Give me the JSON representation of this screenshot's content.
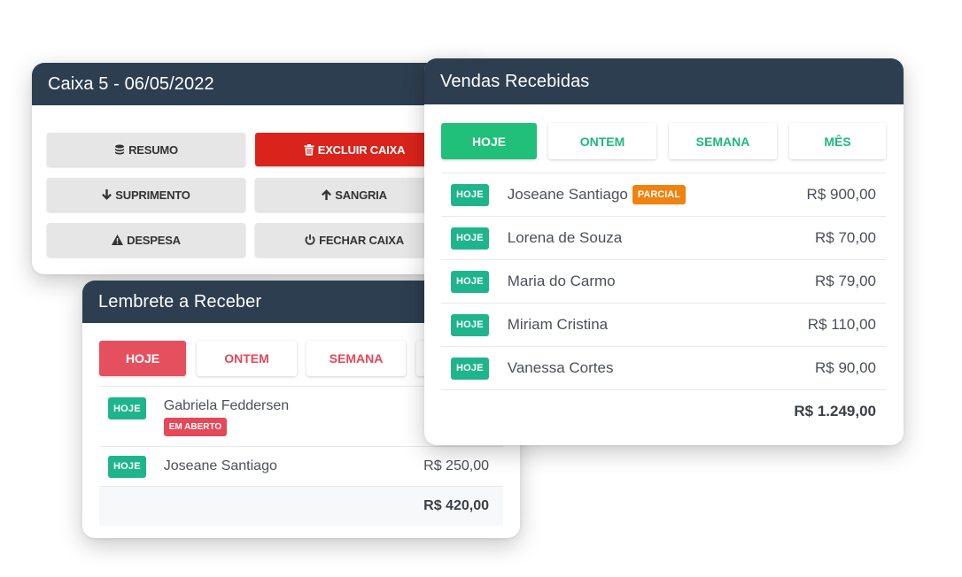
{
  "caixa": {
    "title": "Caixa 5 - 06/05/2022",
    "buttons": {
      "resumo": "RESUMO",
      "excluir": "EXCLUIR CAIXA",
      "suprimento": "SUPRIMENTO",
      "sangria": "SANGRIA",
      "despesa": "DESPESA",
      "fechar": "FECHAR CAIXA"
    },
    "colors": {
      "danger": "#d9231b",
      "header": "#2d3e50"
    }
  },
  "lembrete": {
    "title": "Lembrete a Receber",
    "tabs": [
      "HOJE",
      "ONTEM",
      "SEMANA"
    ],
    "active_tab": "HOJE",
    "rows": [
      {
        "badge": "HOJE",
        "name": "Gabriela Feddersen",
        "status": "EM ABERTO"
      },
      {
        "badge": "HOJE",
        "name": "Joseane Santiago",
        "amount": "R$ 250,00"
      }
    ],
    "total": "R$ 420,00",
    "colors": {
      "accent": "#e5505f"
    }
  },
  "vendas": {
    "title": "Vendas Recebidas",
    "tabs": [
      "HOJE",
      "ONTEM",
      "SEMANA",
      "MÊS"
    ],
    "active_tab": "HOJE",
    "rows": [
      {
        "badge": "HOJE",
        "name": "Joseane Santiago",
        "tag": "PARCIAL",
        "amount": "R$ 900,00"
      },
      {
        "badge": "HOJE",
        "name": "Lorena de Souza",
        "amount": "R$ 70,00"
      },
      {
        "badge": "HOJE",
        "name": "Maria do Carmo",
        "amount": "R$ 79,00"
      },
      {
        "badge": "HOJE",
        "name": "Miriam Cristina",
        "amount": "R$ 110,00"
      },
      {
        "badge": "HOJE",
        "name": "Vanessa Cortes",
        "amount": "R$ 90,00"
      }
    ],
    "total": "R$ 1.249,00",
    "colors": {
      "accent": "#20bf7a",
      "badge": "#1fb58c",
      "partial": "#f0820f"
    }
  }
}
